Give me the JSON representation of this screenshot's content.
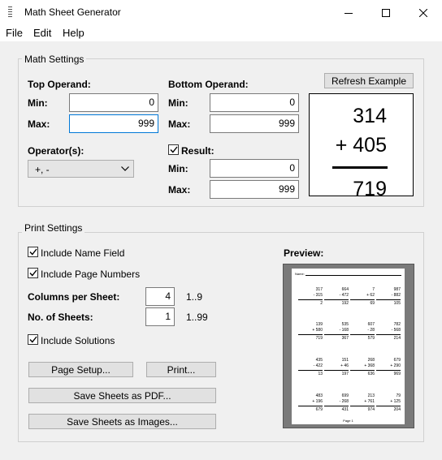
{
  "window": {
    "title": "Math Sheet Generator"
  },
  "menu": {
    "file": "File",
    "edit": "Edit",
    "help": "Help"
  },
  "math_settings": {
    "group_label": "Math Settings",
    "top_operand": {
      "label": "Top Operand:",
      "min_label": "Min:",
      "min_value": "0",
      "max_label": "Max:",
      "max_value": "999"
    },
    "bottom_operand": {
      "label": "Bottom Operand:",
      "min_label": "Min:",
      "min_value": "0",
      "max_label": "Max:",
      "max_value": "999"
    },
    "operators": {
      "label": "Operator(s):",
      "selected": "+, -"
    },
    "result": {
      "label": "Result:",
      "checked": true,
      "min_label": "Min:",
      "min_value": "0",
      "max_label": "Max:",
      "max_value": "999"
    },
    "refresh_label": "Refresh Example",
    "example": {
      "top": "314",
      "bottom": "+ 405",
      "answer": "719"
    }
  },
  "print_settings": {
    "group_label": "Print Settings",
    "include_name_field": {
      "label": "Include Name Field",
      "checked": true
    },
    "include_page_numbers": {
      "label": "Include Page Numbers",
      "checked": true
    },
    "columns": {
      "label": "Columns per Sheet:",
      "value": "4",
      "range": "1..9"
    },
    "sheets": {
      "label": "No. of Sheets:",
      "value": "1",
      "range": "1..99"
    },
    "include_solutions": {
      "label": "Include Solutions",
      "checked": true
    },
    "page_setup_label": "Page Setup...",
    "print_label": "Print...",
    "save_pdf_label": "Save Sheets as PDF...",
    "save_images_label": "Save Sheets as Images...",
    "preview_label": "Preview:",
    "preview": {
      "name_label": "Name:",
      "page_label": "Page 1",
      "rows": [
        [
          [
            "317",
            "- 315",
            "2"
          ],
          [
            "664",
            "- 472",
            "192"
          ],
          [
            "7",
            "+ 62",
            "69"
          ],
          [
            "987",
            "- 882",
            "105"
          ]
        ],
        [
          [
            "139",
            "+ 580",
            "719"
          ],
          [
            "535",
            "- 168",
            "367"
          ],
          [
            "607",
            "- 28",
            "579"
          ],
          [
            "782",
            "- 568",
            "214"
          ]
        ],
        [
          [
            "435",
            "- 422",
            "13"
          ],
          [
            "151",
            "+ 46",
            "197"
          ],
          [
            "268",
            "+ 368",
            "636"
          ],
          [
            "679",
            "+ 290",
            "969"
          ]
        ],
        [
          [
            "483",
            "+ 196",
            "679"
          ],
          [
            "699",
            "- 268",
            "431"
          ],
          [
            "213",
            "+ 761",
            "974"
          ],
          [
            "79",
            "+ 125",
            "204"
          ]
        ]
      ]
    }
  },
  "colors": {
    "focus_border": "#0078d7",
    "window_bg": "#f0f0f0",
    "preview_bg": "#7a7a7a"
  }
}
